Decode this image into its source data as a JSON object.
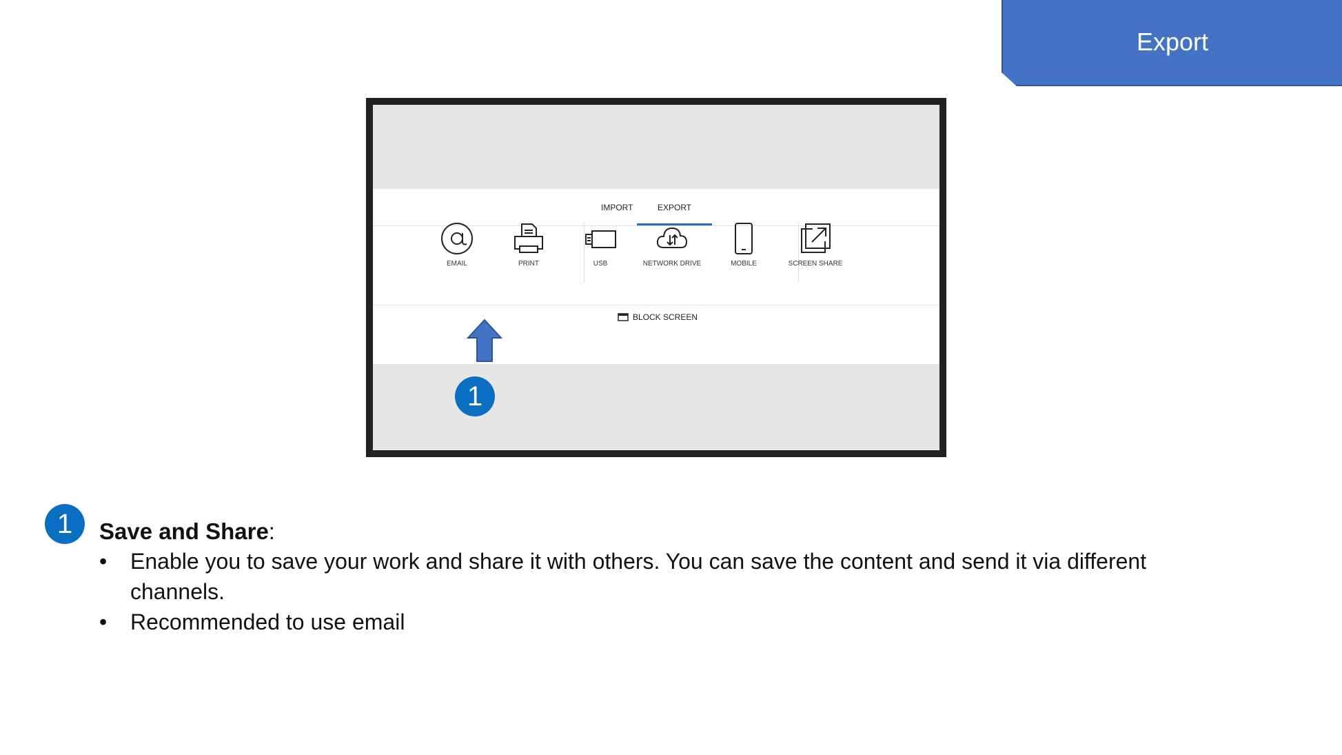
{
  "header": {
    "title": "Export"
  },
  "screen": {
    "tabs": [
      {
        "label": "IMPORT",
        "active": false
      },
      {
        "label": "EXPORT",
        "active": true
      }
    ],
    "options": [
      {
        "label": "EMAIL",
        "icon": "at-icon"
      },
      {
        "label": "PRINT",
        "icon": "printer-icon"
      },
      {
        "label": "USB",
        "icon": "usb-icon"
      },
      {
        "label": "NETWORK DRIVE",
        "icon": "cloud-icon"
      },
      {
        "label": "MOBILE",
        "icon": "mobile-icon"
      },
      {
        "label": "SCREEN SHARE",
        "icon": "screen-share-icon"
      }
    ],
    "block_screen_label": "BLOCK SCREEN",
    "marker_number": "1"
  },
  "note": {
    "number": "1",
    "title": "Save and Share",
    "title_suffix": ":",
    "bullets": [
      "Enable you to save your work and share it with others. You can save the content and send it via different channels.",
      "Recommended to use email"
    ]
  },
  "colors": {
    "accent": "#4472c4",
    "badge": "#0a6fc2",
    "tab_underline": "#1f6fc5"
  }
}
